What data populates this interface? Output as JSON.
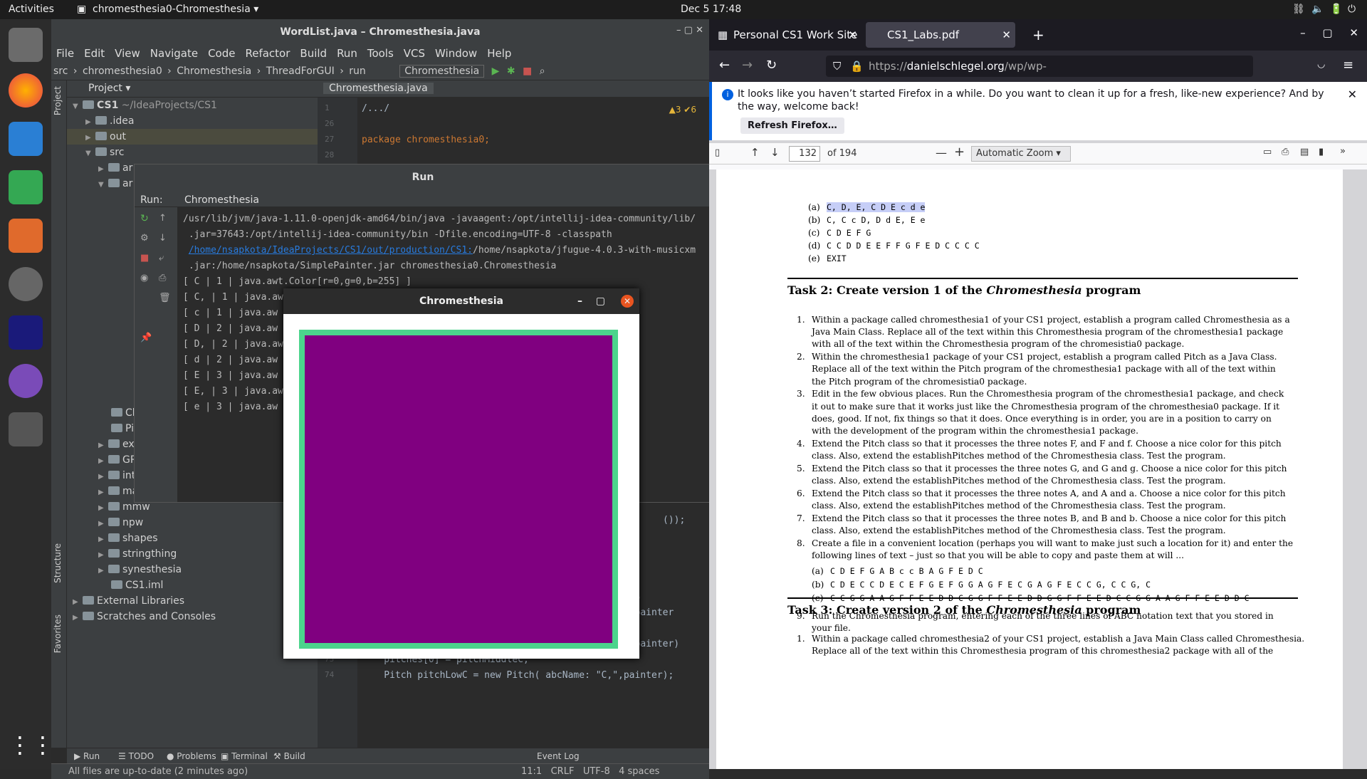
{
  "topbar": {
    "activities": "Activities",
    "app": "chromesthesia0-Chromesthesia ▾",
    "clock": "Dec 5  17:48"
  },
  "idea": {
    "title": "WordList.java – Chromesthesia.java",
    "menu": [
      "File",
      "Edit",
      "View",
      "Navigate",
      "Code",
      "Refactor",
      "Build",
      "Run",
      "Tools",
      "VCS",
      "Window",
      "Help"
    ],
    "nav": [
      "src",
      "chromesthesia0",
      "Chromesthesia",
      "ThreadForGUI",
      "run"
    ],
    "run_config": "Chromesthesia",
    "project_label": "Project ▾",
    "tree": [
      {
        "indent": 0,
        "open": true,
        "label": "CS1",
        "extra": " ~/IdeaProjects/CS1",
        "bold": true
      },
      {
        "indent": 1,
        "open": false,
        "label": ".idea"
      },
      {
        "indent": 1,
        "open": false,
        "label": "out",
        "hl": true
      },
      {
        "indent": 1,
        "open": true,
        "label": "src"
      },
      {
        "indent": 2,
        "open": false,
        "label": "ar"
      },
      {
        "indent": 2,
        "open": true,
        "label": "ar"
      }
    ],
    "tree_bottom": [
      "Chromesthesia",
      "Pitch",
      "expressions",
      "GREETINGS",
      "interpreters",
      "mathematics",
      "mmw",
      "npw",
      "shapes",
      "stringthing",
      "synesthesia",
      "CS1.iml",
      "External Libraries",
      "Scratches and Consoles"
    ],
    "editor_tab": "Chromesthesia.java",
    "editor_inspections": "▲3  ✔6",
    "code_top": [
      {
        "ln": "1",
        "text": "/.../"
      },
      {
        "ln": "26",
        "text": ""
      },
      {
        "ln": "27",
        "text": "package chromesthesia0;"
      },
      {
        "ln": "28",
        "text": ""
      }
    ],
    "code_bottom": [
      {
        "ln": "",
        "text": "// METHODS PERTAINING TO THE CHROMESTHESIA PITCHES"
      },
      {
        "ln": "70",
        "text": "private static Pitch[] establishPitches(SPainter painter"
      },
      {
        "ln": "71",
        "text": "    Pitch[] pitches = new Pitch[9];"
      },
      {
        "ln": "72",
        "text": "    Pitch pitchMiddleC = new Pitch( abcName: \"C\",painter)"
      },
      {
        "ln": "73",
        "text": "    pitches[0] = pitchMiddleC;"
      },
      {
        "ln": "74",
        "text": "    Pitch pitchLowC = new Pitch( abcName: \"C,\",painter);"
      }
    ],
    "code_partial": "());",
    "bottom_tabs": [
      "▶ Run",
      "☰ TODO",
      "● Problems",
      "▣ Terminal",
      "⚒ Build"
    ],
    "event_log": "Event Log",
    "status_left": "All files are up-to-date (2 minutes ago)",
    "status_right": "11:1   CRLF   UTF-8   4 spaces",
    "strip_project": "Project",
    "strip_structure": "Structure",
    "strip_favorites": "Favorites"
  },
  "run": {
    "title": "Run",
    "label": "Run:",
    "tab": "Chromesthesia",
    "lines": [
      "/usr/lib/jvm/java-1.11.0-openjdk-amd64/bin/java -javaagent:/opt/intellij-idea-community/lib/",
      " .jar=37643:/opt/intellij-idea-community/bin -Dfile.encoding=UTF-8 -classpath",
      "[ C | 1 | java.awt.Color[r=0,g=0,b=255] ]",
      "[ C, | 1 | java.aw",
      "[ c | 1 | java.aw",
      "[ D | 2 | java.aw",
      "[ D, | 2 | java.aw",
      "[ d | 2 | java.aw",
      "[ E | 3 | java.aw",
      "[ E, | 3 | java.aw",
      "[ e | 3 | java.aw"
    ],
    "link": "/home/nsapkota/IdeaProjects/CS1/out/production/CS1:",
    "link_rest": "/home/nsapkota/jfugue-4.0.3-with-musicxm",
    "line4": " .jar:/home/nsapkota/SimplePainter.jar chromesthesia0.Chromesthesia"
  },
  "chromesthesia": {
    "title": "Chromesthesia",
    "border_color": "#4bd48c",
    "fill_color": "#800080"
  },
  "firefox": {
    "tab1": "Personal CS1 Work Site",
    "tab2": "CS1_Labs.pdf",
    "url_prefix": "https://",
    "url_domain": "danielschlegel.org",
    "url_path": "/wp/wp-content/uploads/2020/01/CS1_Labs.pdf",
    "notice": "It looks like you haven’t started Firefox in a while. Do you want to clean it up for a fresh, like-new experience? And by the way, welcome back!",
    "refresh_btn": "Refresh Firefox…",
    "page_num": "132",
    "page_total": "of 194",
    "zoom": "Automatic Zoom"
  },
  "pdf": {
    "list_a": [
      {
        "k": "(a)",
        "v": "C, D, E, C D E c d e",
        "sel": true
      },
      {
        "k": "(b)",
        "v": "C, C c D, D d E, E e"
      },
      {
        "k": "(c)",
        "v": "C D E F G"
      },
      {
        "k": "(d)",
        "v": "C C D D E E F F G F E D C C C C"
      },
      {
        "k": "(e)",
        "v": "EXIT"
      }
    ],
    "task2_pre": "Task 2:  Create version 1 of the ",
    "task2_em": "Chromesthesia",
    "task2_post": " program",
    "task2_items": [
      [
        "1.",
        "Within a package called chromesthesia1 of your CS1 project, establish a program called Chromesthesia as a",
        "Java Main Class. Replace all of the text within this Chromesthesia program of the chromesthesia1 package",
        "with all of the text within the Chromesthesia program of the chromesistia0 package."
      ],
      [
        "2.",
        "Within the chromesthesia1 package of your CS1 project, establish a program called Pitch as a Java Class.",
        "Replace all of the text within the Pitch program of the chromesthesia1 package with all of the text within",
        "the Pitch program of the chromesistia0 package."
      ],
      [
        "3.",
        "Edit in the few obvious places. Run the Chromesthesia program of the chromesthesia1 package, and check",
        "it out to make sure that it works just like the Chromesthesia program of the chromesthesia0 package. If it",
        "does, good.  If not, fix things so that it does.  Once everything is in order, you are in a position to carry on",
        "with the development of the program within the chromesthesia1 package."
      ],
      [
        "4.",
        "Extend the Pitch class so that it processes the three notes F, and F and f. Choose a nice color for this pitch",
        "class. Also, extend the establishPitches method of the Chromesthesia class. Test the program."
      ],
      [
        "5.",
        "Extend the Pitch class so that it processes the three notes G, and G and g. Choose a nice color for this pitch",
        "class. Also, extend the establishPitches method of the Chromesthesia class. Test the program."
      ],
      [
        "6.",
        "Extend the Pitch class so that it processes the three notes A, and A and a. Choose a nice color for this pitch",
        "class. Also, extend the establishPitches method of the Chromesthesia class. Test the program."
      ],
      [
        "7.",
        "Extend the Pitch class so that it processes the three notes B, and B and b. Choose a nice color for this pitch",
        "class. Also, extend the establishPitches method of the Chromesthesia class. Test the program."
      ],
      [
        "8.",
        "Create a file in a convenient location (perhaps you will want to make just such a location for it) and enter the",
        "following lines of text – just so that you will be able to copy and paste them at will ..."
      ]
    ],
    "sub8": [
      {
        "k": "(a)",
        "v": "C D E F G A B c c B A G F E D C"
      },
      {
        "k": "(b)",
        "v": "C D E C C D E C E F G E F G G A G F E C G A G F E C C G, C C G, C"
      },
      {
        "k": "(c)",
        "v": "C C G G A A G F F E E D D C G G F F E E D D G G F F E E D C C G G A A G F F E E D D C"
      }
    ],
    "item9": [
      "9.",
      "Run the Chromesthesia program, entering each of the three lines of ABC notation text that you stored in",
      "your file."
    ],
    "task3_pre": "Task 3:  Create version 2 of the ",
    "task3_em": "Chromesthesia",
    "task3_post": " program",
    "task3_item": [
      "1.",
      "Within a package called chromesthesia2 of your CS1 project, establish a Java Main Class called Chromesthesia.",
      "Replace all of the text within this Chromesthesia program of this chromesthesia2 package with all of the"
    ]
  }
}
